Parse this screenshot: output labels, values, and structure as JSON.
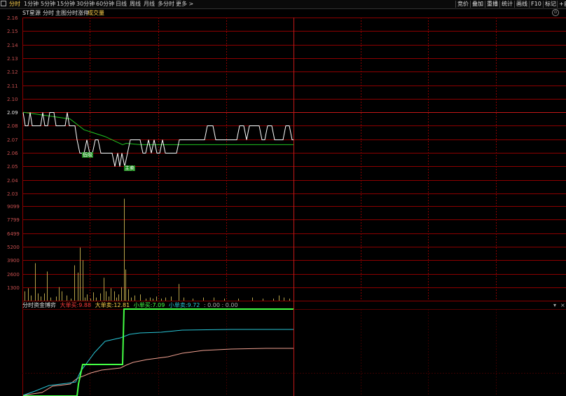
{
  "toolbar": {
    "square_icon": "square-icon",
    "tabs": [
      {
        "label": "分时",
        "active": true
      },
      {
        "label": "1分钟"
      },
      {
        "label": "5分钟"
      },
      {
        "label": "15分钟"
      },
      {
        "label": "30分钟"
      },
      {
        "label": "60分钟"
      },
      {
        "label": "日线"
      },
      {
        "label": "周线"
      },
      {
        "label": "月线"
      },
      {
        "label": "多分时"
      },
      {
        "label": "更多 >"
      }
    ],
    "right_buttons": [
      "竞价",
      "叠加",
      "重播",
      "统计",
      "画线",
      "F10",
      "标记",
      "+自"
    ]
  },
  "titlebar": {
    "stock_name": "ST星源",
    "mode": "分时",
    "overlay": "主图分时涨停",
    "volume_label": "成交量"
  },
  "price_axis": [
    "2.16",
    "2.15",
    "2.14",
    "2.13",
    "2.12",
    "2.11",
    "2.10",
    "2.09",
    "2.08",
    "2.07",
    "2.06",
    "2.05",
    "2.04",
    "2.03"
  ],
  "volume_axis": [
    "9099",
    "7799",
    "6499",
    "5200",
    "3900",
    "2600",
    "1300"
  ],
  "markers": {
    "lower_buy": "低吸",
    "main_sell": "主卖"
  },
  "lower_panel": {
    "title": "分时资金博弈",
    "big_buy_label": "大单买:",
    "big_buy_value": "9.88",
    "big_sell_label": "大单卖:",
    "big_sell_value": "12.81",
    "small_buy_label": "小单买:",
    "small_buy_value": "7.09",
    "small_sell_label": "小单卖:",
    "small_sell_value": "9.72",
    "extra": ": 0.00 : 0.00",
    "close_icon": "close-icon",
    "collapse_icon": "collapse-icon"
  },
  "colors": {
    "grid": "#8b0000",
    "price_line": "#ffffff",
    "avg_line": "#21c321",
    "volume_bar": "#b8a44a",
    "big_buy": "#ff3a3a",
    "big_sell": "#44ff44",
    "small_buy": "#29c5d6",
    "small_sell": "#f0a090",
    "text_yellow": "#ffd24a",
    "text_cyan": "#29c5d6"
  }
}
